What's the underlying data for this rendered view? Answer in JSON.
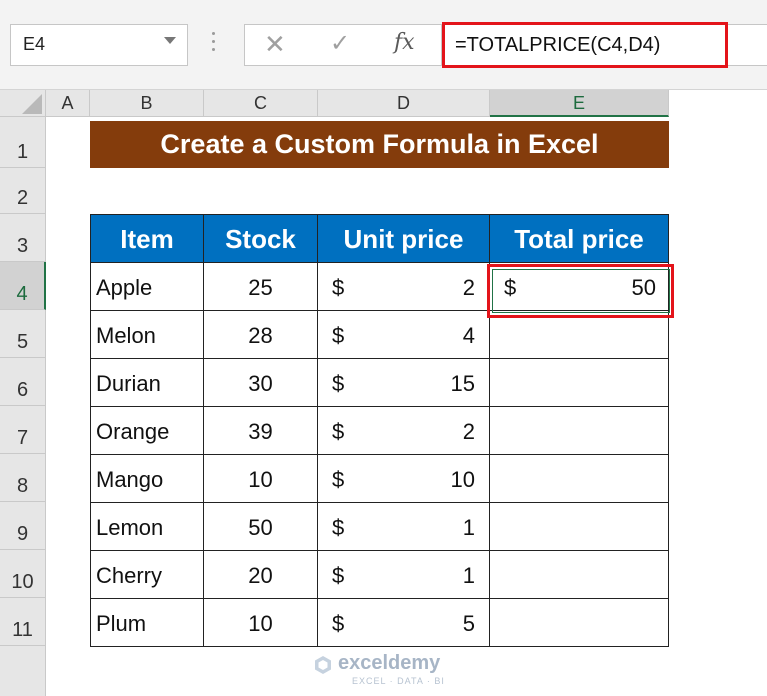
{
  "formula_bar": {
    "name_box": "E4",
    "formula": "=TOTALPRICE(C4,D4)"
  },
  "icons": {
    "cancel": "✕",
    "enter": "✓",
    "fx": "fx"
  },
  "columns": [
    "A",
    "B",
    "C",
    "D",
    "E"
  ],
  "rows": [
    "1",
    "2",
    "3",
    "4",
    "5",
    "6",
    "7",
    "8",
    "9",
    "10",
    "11"
  ],
  "selected_cell": "E4",
  "title": "Create a Custom Formula in Excel",
  "table": {
    "headers": [
      "Item",
      "Stock",
      "Unit price",
      "Total price"
    ],
    "rows": [
      {
        "item": "Apple",
        "stock": "25",
        "currency": "$",
        "price": "2"
      },
      {
        "item": "Melon",
        "stock": "28",
        "currency": "$",
        "price": "4"
      },
      {
        "item": "Durian",
        "stock": "30",
        "currency": "$",
        "price": "15"
      },
      {
        "item": "Orange",
        "stock": "39",
        "currency": "$",
        "price": "2"
      },
      {
        "item": "Mango",
        "stock": "10",
        "currency": "$",
        "price": "10"
      },
      {
        "item": "Lemon",
        "stock": "50",
        "currency": "$",
        "price": "1"
      },
      {
        "item": "Cherry",
        "stock": "20",
        "currency": "$",
        "price": "1"
      },
      {
        "item": "Plum",
        "stock": "10",
        "currency": "$",
        "price": "5"
      }
    ]
  },
  "e4": {
    "currency": "$",
    "value": "50"
  },
  "watermark": {
    "name": "exceldemy",
    "tagline": "EXCEL · DATA · BI"
  },
  "colors": {
    "title_bg": "#843c0c",
    "header_bg": "#0070c0",
    "highlight": "#e3141a",
    "selection": "#217346"
  }
}
